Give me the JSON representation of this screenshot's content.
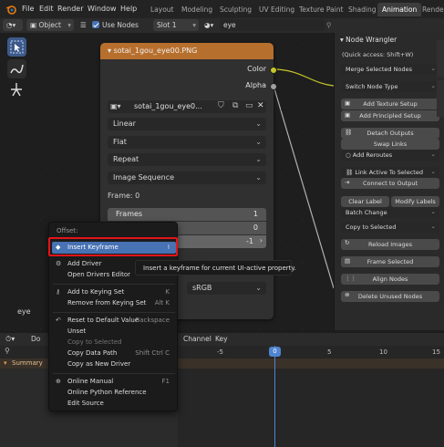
{
  "menubar": {
    "items": [
      "File",
      "Edit",
      "Render",
      "Window",
      "Help"
    ],
    "workspaces": [
      "Layout",
      "Modeling",
      "Sculpting",
      "UV Editing",
      "Texture Paint",
      "Shading",
      "Animation",
      "Rende"
    ],
    "active_workspace": "Animation"
  },
  "header": {
    "mode": "Object",
    "use_nodes": "Use Nodes",
    "slot": "Slot 1",
    "material": "eye"
  },
  "node": {
    "title": "sotai_1gou_eye00.PNG",
    "outputs": [
      "Color",
      "Alpha"
    ],
    "image_name": "sotai_1gou_eye0...",
    "interpolation": "Linear",
    "projection": "Flat",
    "extension": "Repeat",
    "source": "Image Sequence",
    "frame_label": "Frame: 0",
    "frames_label": "Frames",
    "frames_value": "1",
    "start_value": "0",
    "offset_value": "-1",
    "colorspace": "sRGB",
    "colors": {
      "header": "#b76f2d",
      "color_socket": "#c7c729",
      "alpha_socket": "#a0a0a0"
    }
  },
  "viewport_label": "eye",
  "npanel": {
    "title": "Node Wrangler",
    "quick_access": "(Quick access: Shift+W)",
    "buttons": [
      "Merge Selected Nodes",
      "Switch Node Type",
      "Add Texture Setup",
      "Add Principled Setup",
      "Detach Outputs",
      "Swap Links",
      "Add Reroutes",
      "Link Active To Selected",
      "Connect to Output",
      "Clear Label",
      "Modify Labels",
      "Batch Change",
      "Copy to Selected",
      "Reload Images",
      "Frame Selected",
      "Align Nodes",
      "Delete Unused Nodes"
    ]
  },
  "context_menu": {
    "title": "Offset:",
    "items": [
      {
        "label": "Insert Keyframe",
        "shortcut": "I",
        "icon": "keyframe-icon",
        "highlight": true
      },
      {
        "label": "Add Driver",
        "shortcut": "",
        "icon": "driver-icon"
      },
      {
        "label": "Open Drivers Editor",
        "shortcut": "",
        "icon": ""
      },
      {
        "label": "Add to Keying Set",
        "shortcut": "K",
        "icon": "keying-set-icon"
      },
      {
        "label": "Remove from Keying Set",
        "shortcut": "Alt K",
        "icon": ""
      },
      {
        "label": "Reset to Default Value",
        "shortcut": "Backspace",
        "icon": "reset-icon"
      },
      {
        "label": "Unset",
        "shortcut": "",
        "icon": ""
      },
      {
        "label": "Copy to Selected",
        "shortcut": "",
        "icon": "",
        "disabled": true
      },
      {
        "label": "Copy Data Path",
        "shortcut": "Shift Ctrl C",
        "icon": ""
      },
      {
        "label": "Copy as New Driver",
        "shortcut": "",
        "icon": ""
      },
      {
        "label": "Online Manual",
        "shortcut": "F1",
        "icon": "help-icon"
      },
      {
        "label": "Online Python Reference",
        "shortcut": "",
        "icon": ""
      },
      {
        "label": "Edit Source",
        "shortcut": "",
        "icon": ""
      }
    ]
  },
  "tooltip": "Insert a keyframe for current UI-active property.",
  "timeline": {
    "header_items": [
      "Do",
      "Channel",
      "Key"
    ],
    "ruler": [
      "-5",
      "0",
      "5",
      "10",
      "15"
    ],
    "current_frame": "0",
    "summary": "Summary"
  }
}
